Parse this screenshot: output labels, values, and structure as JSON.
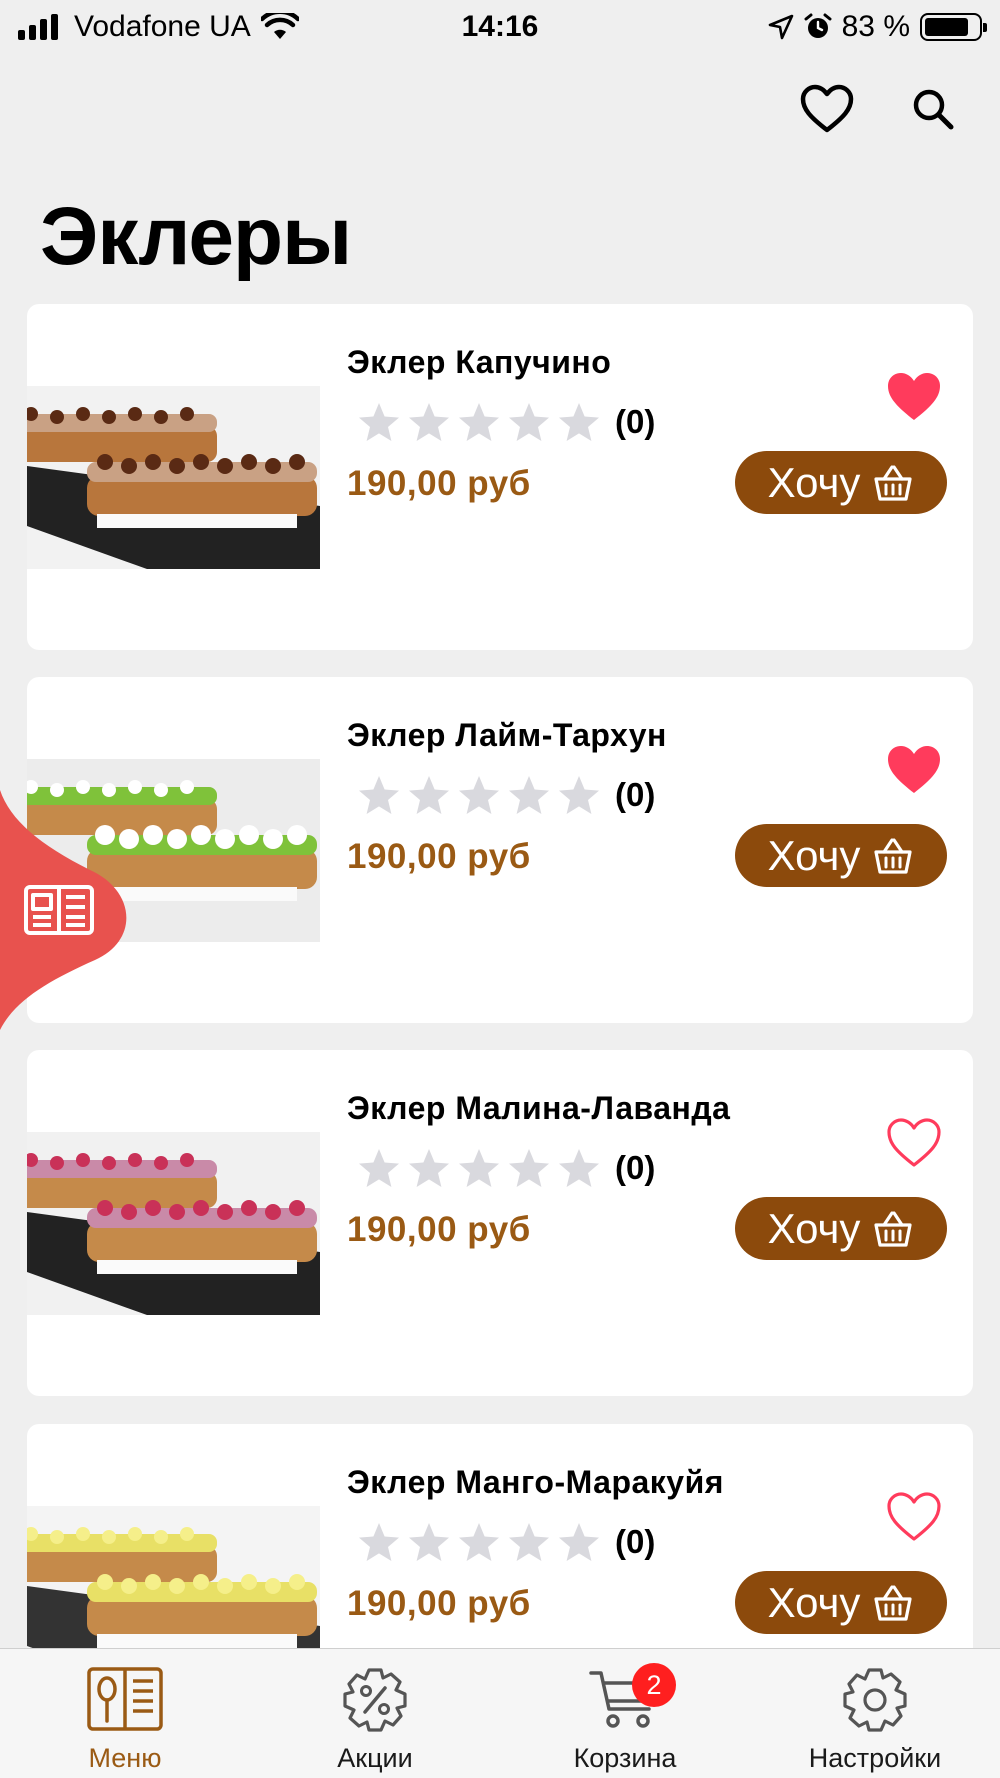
{
  "status_bar": {
    "carrier": "Vodafone UA",
    "time": "14:16",
    "battery": "83 %",
    "battery_level": 0.83
  },
  "header": {
    "title": "Эклеры"
  },
  "colors": {
    "brand_brown": "#8c4a0c",
    "price": "#9a5a14",
    "favorite": "#ff3b5c",
    "side_tab": "#e8524e",
    "badge": "#ff1f1f"
  },
  "products": [
    {
      "name": "Эклер Капучино",
      "rating_count": "(0)",
      "rating_value": 0,
      "price": "190,00 руб",
      "button_label": "Хочу",
      "favorite": true,
      "image_icon": "eclair-cappuccino-photo"
    },
    {
      "name": "Эклер Лайм-Тархун",
      "rating_count": "(0)",
      "rating_value": 0,
      "price": "190,00 руб",
      "button_label": "Хочу",
      "favorite": true,
      "image_icon": "eclair-lime-tarragon-photo"
    },
    {
      "name": "Эклер Малина-Лаванда",
      "rating_count": "(0)",
      "rating_value": 0,
      "price": "190,00 руб",
      "button_label": "Хочу",
      "favorite": false,
      "image_icon": "eclair-raspberry-lavender-photo"
    },
    {
      "name": "Эклер Манго-Маракуйя",
      "rating_count": "(0)",
      "rating_value": 0,
      "price": "190,00 руб",
      "button_label": "Хочу",
      "favorite": false,
      "image_icon": "eclair-mango-passionfruit-photo"
    }
  ],
  "tab_bar": {
    "tabs": [
      {
        "label": "Меню",
        "icon": "menu-book-icon",
        "active": true
      },
      {
        "label": "Акции",
        "icon": "discount-gear-icon",
        "active": false
      },
      {
        "label": "Корзина",
        "icon": "cart-icon",
        "active": false,
        "badge": "2"
      },
      {
        "label": "Настройки",
        "icon": "settings-gear-icon",
        "active": false
      }
    ]
  }
}
